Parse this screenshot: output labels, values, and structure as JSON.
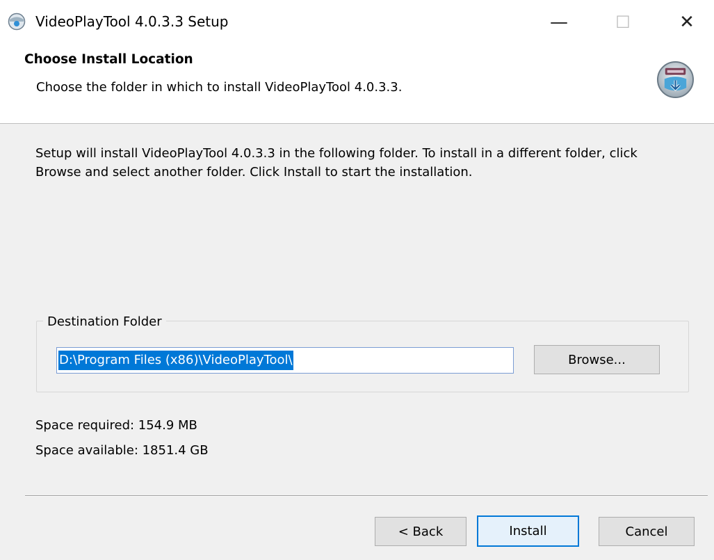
{
  "window": {
    "title": "VideoPlayTool 4.0.3.3 Setup",
    "minimize_glyph": "—",
    "maximize_glyph": "☐",
    "close_glyph": "✕"
  },
  "header": {
    "title": "Choose Install Location",
    "subtitle": "Choose the folder in which to install VideoPlayTool 4.0.3.3.",
    "logo_icon": "installer-disc-icon"
  },
  "body": {
    "intro": "Setup will install VideoPlayTool 4.0.3.3 in the following folder. To install in a different folder, click Browse and select another folder. Click Install to start the installation."
  },
  "destination": {
    "group_label": "Destination Folder",
    "path": "D:\\Program Files (x86)\\VideoPlayTool\\",
    "browse_label": "Browse..."
  },
  "space": {
    "required": "Space required: 154.9 MB",
    "available": "Space available: 1851.4 GB"
  },
  "buttons": {
    "back": "< Back",
    "install": "Install",
    "cancel": "Cancel"
  },
  "colors": {
    "selection": "#0078d7",
    "default_button_border": "#0078d7"
  }
}
